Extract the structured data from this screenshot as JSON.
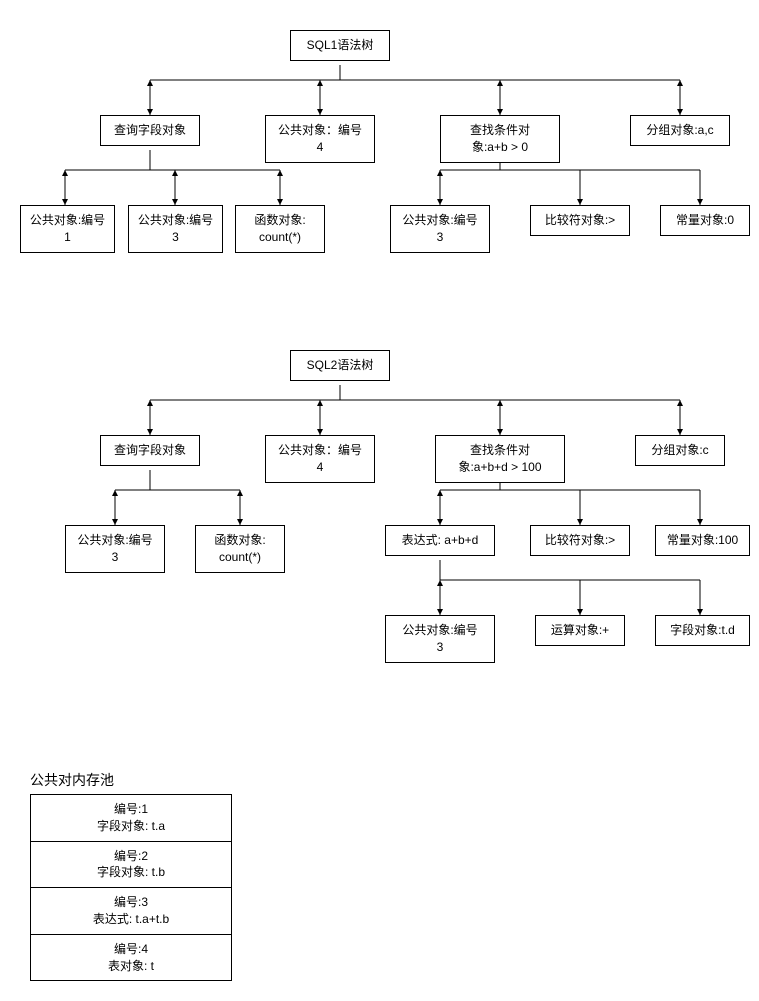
{
  "sql1": {
    "root": "SQL1语法树",
    "queryField": "查询字段对象",
    "pubObj4": "公共对象：编号\n4",
    "searchCond": "查找条件对\n象:a+b > 0",
    "groupObj": "分组对象:a,c",
    "pubObj1": "公共对象:编号\n1",
    "pubObj3a": "公共对象:编号\n3",
    "funcObj": "函数对象:\ncount(*)",
    "pubObj3b": "公共对象:编号\n3",
    "compObj": "比较符对象:>",
    "constObj": "常量对象:0"
  },
  "sql2": {
    "root": "SQL2语法树",
    "queryField": "查询字段对象",
    "pubObj4": "公共对象：编号\n4",
    "searchCond": "查找条件对\n象:a+b+d > 100",
    "groupObj": "分组对象:c",
    "pubObj3a": "公共对象:编号\n3",
    "funcObj": "函数对象:\ncount(*)",
    "exprAbd": "表达式: a+b+d",
    "compObj": "比较符对象:>",
    "constObj": "常量对象:100",
    "pubObj3b": "公共对象:编号\n3",
    "opObj": "运算对象:+",
    "fieldObj": "字段对象:t.d"
  },
  "pool": {
    "title": "公共对内存池",
    "rows": [
      "编号:1\n字段对象: t.a",
      "编号:2\n字段对象: t.b",
      "编号:3\n表达式: t.a+t.b",
      "编号:4\n表对象: t"
    ]
  }
}
